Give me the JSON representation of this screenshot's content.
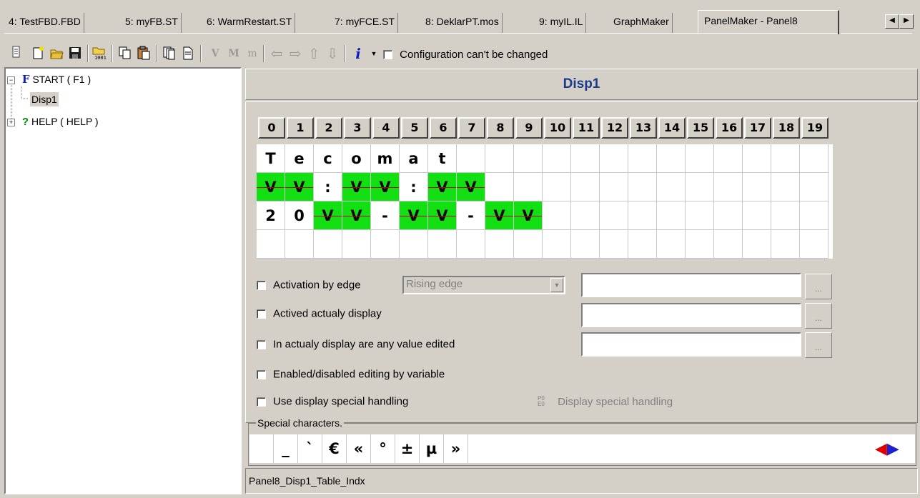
{
  "tabs": [
    {
      "label": "4: TestFBD.FBD"
    },
    {
      "label": "5: myFB.ST"
    },
    {
      "label": "6: WarmRestart.ST"
    },
    {
      "label": "7: myFCE.ST"
    },
    {
      "label": "8: DeklarPT.mos"
    },
    {
      "label": "9: myIL.IL"
    },
    {
      "label": "GraphMaker"
    },
    {
      "label": "PanelMaker - Panel8"
    }
  ],
  "toolbar": {
    "config_label": "Configuration can't be changed",
    "v1": "V",
    "v2": "M",
    "v3": "m",
    "info": "i",
    "arrow_left": "⇦",
    "arrow_right": "⇨",
    "arrow_up": "⇧",
    "arrow_down": "⇩"
  },
  "tree": {
    "start_prefix": "F",
    "start_label": "START ( F1 )",
    "disp_label": "Disp1",
    "help_prefix": "?",
    "help_label": "HELP ( HELP )"
  },
  "panel": {
    "title": "Disp1",
    "columns": [
      "0",
      "1",
      "2",
      "3",
      "4",
      "5",
      "6",
      "7",
      "8",
      "9",
      "10",
      "11",
      "12",
      "13",
      "14",
      "15",
      "16",
      "17",
      "18",
      "19"
    ],
    "rows": [
      [
        "T",
        "e",
        "c",
        "o",
        "m",
        "a",
        "t",
        "",
        "",
        "",
        "",
        "",
        "",
        "",
        "",
        "",
        "",
        "",
        "",
        ""
      ],
      [
        "V",
        "V",
        ":",
        "V",
        "V",
        ":",
        "V",
        "V",
        "",
        "",
        "",
        "",
        "",
        "",
        "",
        "",
        "",
        "",
        "",
        ""
      ],
      [
        "2",
        "0",
        "V",
        "V",
        "-",
        "V",
        "V",
        "-",
        "V",
        "V",
        "",
        "",
        "",
        "",
        "",
        "",
        "",
        "",
        "",
        ""
      ],
      [
        "",
        "",
        "",
        "",
        "",
        "",
        "",
        "",
        "",
        "",
        "",
        "",
        "",
        "",
        "",
        "",
        "",
        "",
        "",
        ""
      ]
    ],
    "variable_cells": [
      [],
      [
        0,
        1,
        3,
        4,
        6,
        7
      ],
      [
        2,
        3,
        5,
        6,
        8,
        9
      ],
      []
    ]
  },
  "options": {
    "activation": "Activation by edge",
    "edge_select": "Rising edge",
    "actived": "Actived actualy display",
    "edited": "In actualy display are any value edited",
    "enabled": "Enabled/disabled editing by variable",
    "special_use": "Use display special handling",
    "special_button": "Display special handling",
    "special_icon": "P0\nE0",
    "dots": "..."
  },
  "special_chars": {
    "legend": "Special characters.",
    "chars": [
      "",
      "_",
      "`",
      "€",
      "«",
      "°",
      "±",
      "µ",
      "»"
    ],
    "nav_left": "◀",
    "nav_right": "▶"
  },
  "status": {
    "text": "Panel8_Disp1_Table_Indx"
  },
  "colors": {
    "variable_cell": "#13e013",
    "strike": "#c00000",
    "title": "#1a3a8c",
    "nav_left": "#e00000",
    "nav_right": "#2020d0"
  }
}
